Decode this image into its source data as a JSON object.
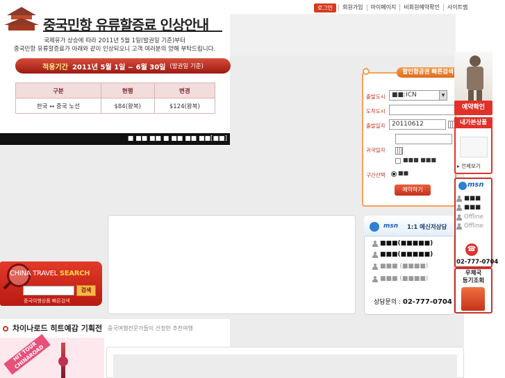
{
  "topnav": {
    "login": "로그인",
    "items": [
      "회원가입",
      "마이페이지",
      "비회원예약확인",
      "사이트맵"
    ]
  },
  "banner": {
    "title": "중국민항 유류할증료 인상안내",
    "desc_line1": "국제유가 상승에 따라 2011년 5월 1일(발권일 기준)부터",
    "desc_line2": "중국민항 유류할증료가 아래와 같이 인상되오니 고객 여러분의 양해 부탁드립니다.",
    "period_label": "적용기간",
    "period_value": "2011년 5월 1일 ~ 6월 30일",
    "period_note": "(발권일 기준)",
    "table": {
      "headers": [
        "구분",
        "현행",
        "변경"
      ],
      "rows": [
        [
          "한국 ↔ 중국 노선",
          "$84(왕복)",
          "$124(왕복)"
        ]
      ]
    },
    "pager": "■ ■■ ■■ ■ ■■ ■■ ■■[■■]"
  },
  "booking": {
    "title": "할인항공권 빠른검색",
    "depart_city_label": "출발도시",
    "depart_city_value": "■■:ICN",
    "arrive_city_label": "도착도시",
    "depart_date_label": "출발일자",
    "depart_date_value": "20110612",
    "return_date_label": "귀국일자",
    "checkbox_label": "■■■ ■■■",
    "trip_type_label": "구간선택",
    "trip_type_value": "■■",
    "reserve_button": "예약하기"
  },
  "right": {
    "confirm": "예약확인",
    "mybox_title": "내가본상품",
    "mybox_view": "▸ 전체보기",
    "msn_logo": "msn",
    "msn_rows": [
      {
        "text": "■■■",
        "status": "online"
      },
      {
        "text": "■■■",
        "status": "online"
      },
      {
        "text": "Offline",
        "status": "offline"
      },
      {
        "text": "Offline",
        "status": "offline"
      }
    ],
    "phone": "02-777-0704",
    "post_line1": "우체국",
    "post_line2": "등기조회"
  },
  "msn": {
    "logo": "msn",
    "title": "1:1 메신저상담",
    "rows": [
      {
        "text": "■■■(■■■■■)",
        "status": "online"
      },
      {
        "text": "■■■(■■■■■)",
        "status": "online"
      },
      {
        "text": "■■■ (■■■■)",
        "status": "offline"
      },
      {
        "text": "■■■ (■■■■)",
        "status": "offline"
      }
    ],
    "phone_label": "상담문의 :",
    "phone_value": "02-777-0704"
  },
  "search": {
    "title_a": "CHINA TRAVEL",
    "title_b": "SEARCH",
    "button": "검색",
    "sub": "중국여행상품 빠른검색"
  },
  "section": {
    "title": "차이나로드 히트예감 기획전",
    "sub": "중국여행전문가들이 선정한 추천여행",
    "ribbon": "HIT TOUR CHINAROAD"
  },
  "colors": {
    "accent": "#e0322a",
    "booking_border": "#f5a15a",
    "msn_blue": "#1a5fb4"
  }
}
